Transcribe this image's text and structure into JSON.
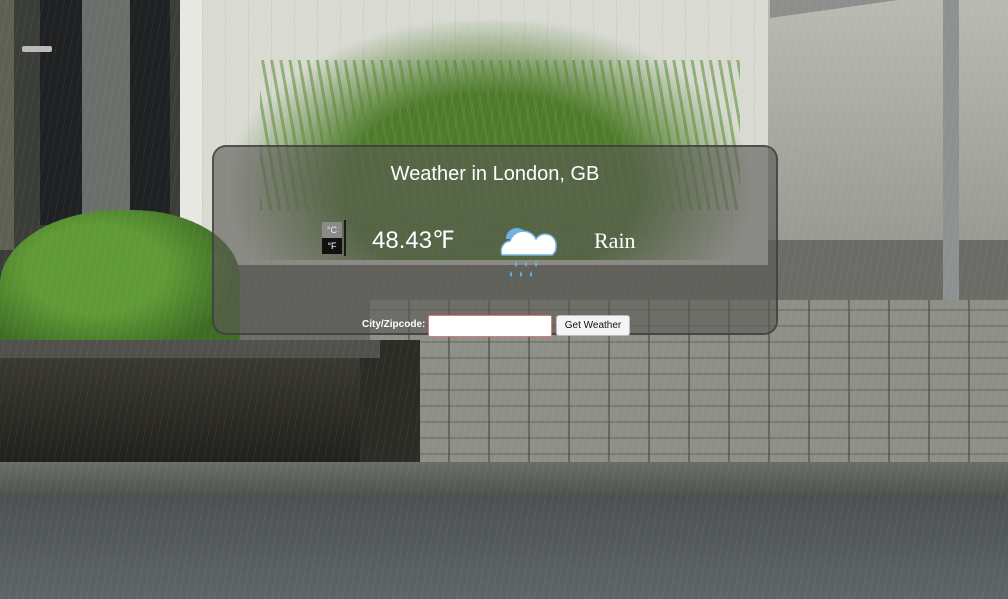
{
  "weather": {
    "title": "Weather in London, GB",
    "temperature": "48.43℉",
    "condition": "Rain",
    "condition_icon": "rain-cloud-icon",
    "unit_toggle": {
      "celsius": "°C",
      "fahrenheit": "°F",
      "selected": "°F"
    }
  },
  "form": {
    "city_label": "City/Zipcode:",
    "city_value": "",
    "submit_label": "Get Weather"
  },
  "colors": {
    "panel_bg": "#5a5855",
    "icon_blue": "#6fb3df",
    "icon_cloud": "#ffffff"
  }
}
